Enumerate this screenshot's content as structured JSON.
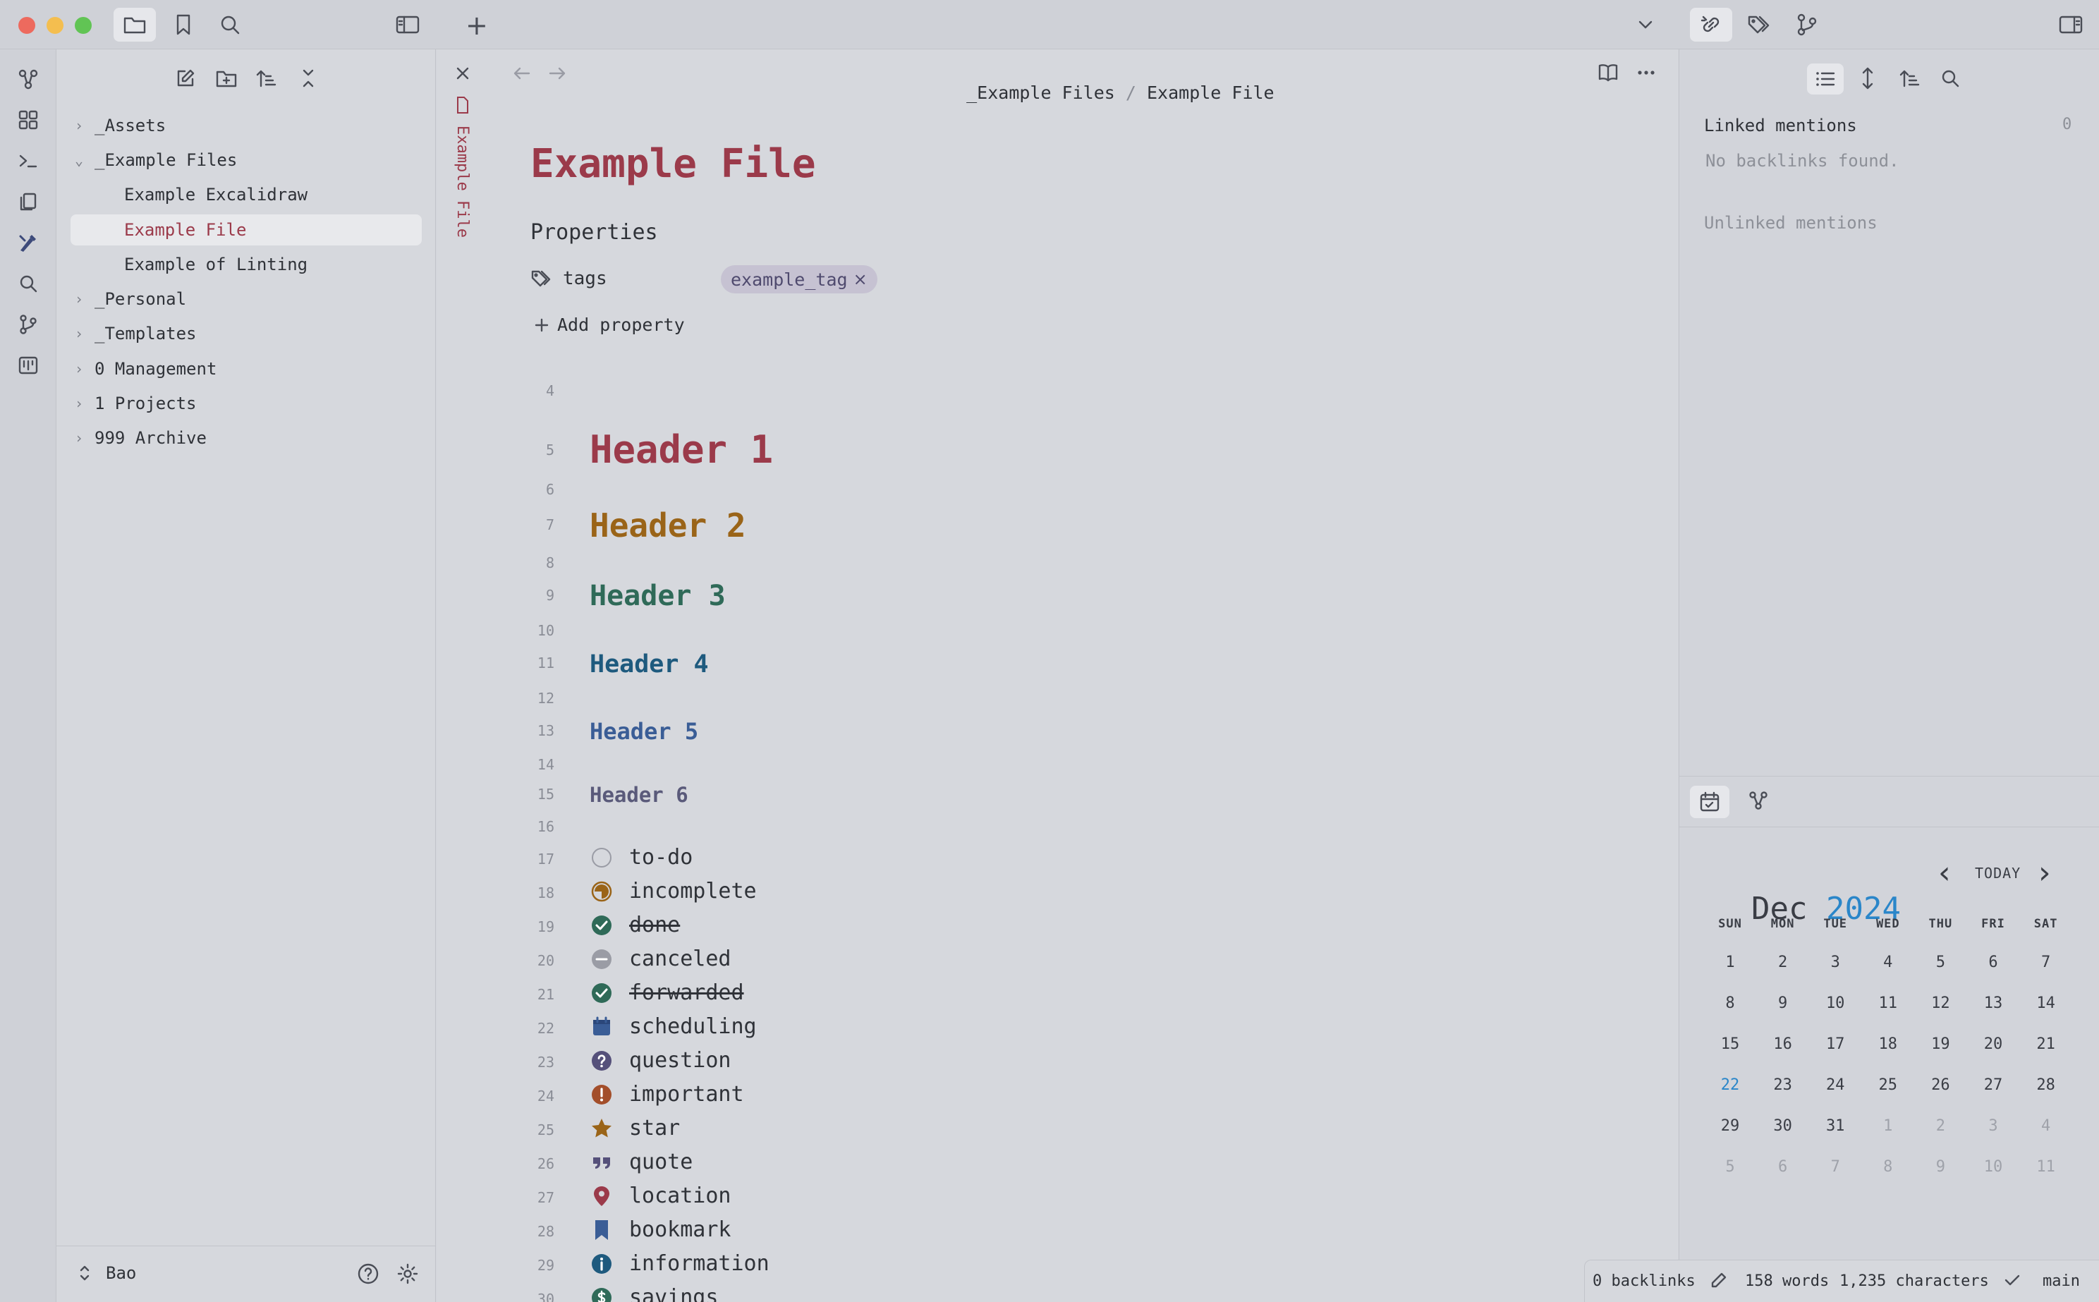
{
  "titlebar": {
    "icons": [
      "folder-icon",
      "bookmark-icon",
      "search-icon",
      "sidebar-toggle-icon"
    ],
    "new_tab": "+",
    "right_icons": [
      "backlinks-icon",
      "tags-icon",
      "git-icon",
      "right-sidebar-icon"
    ]
  },
  "ribbon": {
    "icons": [
      "graph-icon",
      "canvas-icon",
      "terminal-icon",
      "copy-icon",
      "excalidraw-icon",
      "search-icon",
      "git-icon",
      "kanban-icon"
    ]
  },
  "file_tree": {
    "items": [
      {
        "label": "_Assets",
        "type": "folder",
        "expanded": false
      },
      {
        "label": "_Example Files",
        "type": "folder",
        "expanded": true
      },
      {
        "label": "Example Excalidraw",
        "type": "file"
      },
      {
        "label": "Example File",
        "type": "file",
        "active": true
      },
      {
        "label": "Example of Linting",
        "type": "file"
      },
      {
        "label": "_Personal",
        "type": "folder",
        "expanded": false
      },
      {
        "label": "_Templates",
        "type": "folder",
        "expanded": false
      },
      {
        "label": "0 Management",
        "type": "folder",
        "expanded": false
      },
      {
        "label": "1 Projects",
        "type": "folder",
        "expanded": false
      },
      {
        "label": "999 Archive",
        "type": "folder",
        "expanded": false
      }
    ],
    "vault_name": "Bao"
  },
  "editor": {
    "tab_title": "Example File",
    "breadcrumb": {
      "folder": "_Example Files",
      "separator": " / ",
      "file": "Example File"
    },
    "title": "Example File",
    "properties_label": "Properties",
    "property": {
      "name": "tags",
      "value": "example_tag",
      "remove": "×"
    },
    "add_property": "Add property",
    "headers": [
      {
        "line": "5",
        "text": "Header 1",
        "color": "#9b3a4a"
      },
      {
        "line": "7",
        "text": "Header 2",
        "color": "#9a6418"
      },
      {
        "line": "9",
        "text": "Header 3",
        "color": "#2f6a58"
      },
      {
        "line": "11",
        "text": "Header 4",
        "color": "#1e5a7e"
      },
      {
        "line": "13",
        "text": "Header 5",
        "color": "#3a5d96"
      },
      {
        "line": "15",
        "text": "Header 6",
        "color": "#5a5a7a"
      }
    ],
    "blank_lines": [
      "4",
      "6",
      "8",
      "10",
      "12",
      "14",
      "16"
    ],
    "tasks": [
      {
        "line": "17",
        "label": "to-do",
        "icon": "circle-empty-icon"
      },
      {
        "line": "18",
        "label": "incomplete",
        "icon": "half-circle-icon"
      },
      {
        "line": "19",
        "label": "done",
        "icon": "check-circle-icon",
        "strike": true
      },
      {
        "line": "20",
        "label": "canceled",
        "icon": "minus-circle-icon"
      },
      {
        "line": "21",
        "label": "forwarded",
        "icon": "check-circle-icon",
        "strike": true
      },
      {
        "line": "22",
        "label": "scheduling",
        "icon": "calendar-icon"
      },
      {
        "line": "23",
        "label": "question",
        "icon": "question-icon"
      },
      {
        "line": "24",
        "label": "important",
        "icon": "exclamation-icon"
      },
      {
        "line": "25",
        "label": "star",
        "icon": "star-icon"
      },
      {
        "line": "26",
        "label": "quote",
        "icon": "quote-icon"
      },
      {
        "line": "27",
        "label": "location",
        "icon": "location-pin-icon"
      },
      {
        "line": "28",
        "label": "bookmark",
        "icon": "bookmark-icon"
      },
      {
        "line": "29",
        "label": "information",
        "icon": "info-icon"
      },
      {
        "line": "30",
        "label": "savings",
        "icon": "dollar-icon"
      }
    ]
  },
  "backlinks": {
    "linked_label": "Linked mentions",
    "linked_count": "0",
    "no_backlinks": "No backlinks found.",
    "unlinked_label": "Unlinked mentions"
  },
  "calendar": {
    "month": "Dec",
    "year": "2024",
    "today_button": "TODAY",
    "prev": "‹",
    "next": "›",
    "days_of_week": [
      "SUN",
      "MON",
      "TUE",
      "WED",
      "THU",
      "FRI",
      "SAT"
    ],
    "weeks": [
      [
        "1",
        "2",
        "3",
        "4",
        "5",
        "6",
        "7"
      ],
      [
        "8",
        "9",
        "10",
        "11",
        "12",
        "13",
        "14"
      ],
      [
        "15",
        "16",
        "17",
        "18",
        "19",
        "20",
        "21"
      ],
      [
        "22",
        "23",
        "24",
        "25",
        "26",
        "27",
        "28"
      ],
      [
        "29",
        "30",
        "31",
        "1",
        "2",
        "3",
        "4"
      ],
      [
        "5",
        "6",
        "7",
        "8",
        "9",
        "10",
        "11"
      ]
    ],
    "today": "22"
  },
  "status_bar": {
    "backlinks": "0 backlinks",
    "words": "158 words",
    "characters": "1,235 characters",
    "branch": "main"
  },
  "colors": {
    "accent": "#9b3a4a",
    "calendar_year": "#2a86c9",
    "done_green": "#2f6a58"
  }
}
